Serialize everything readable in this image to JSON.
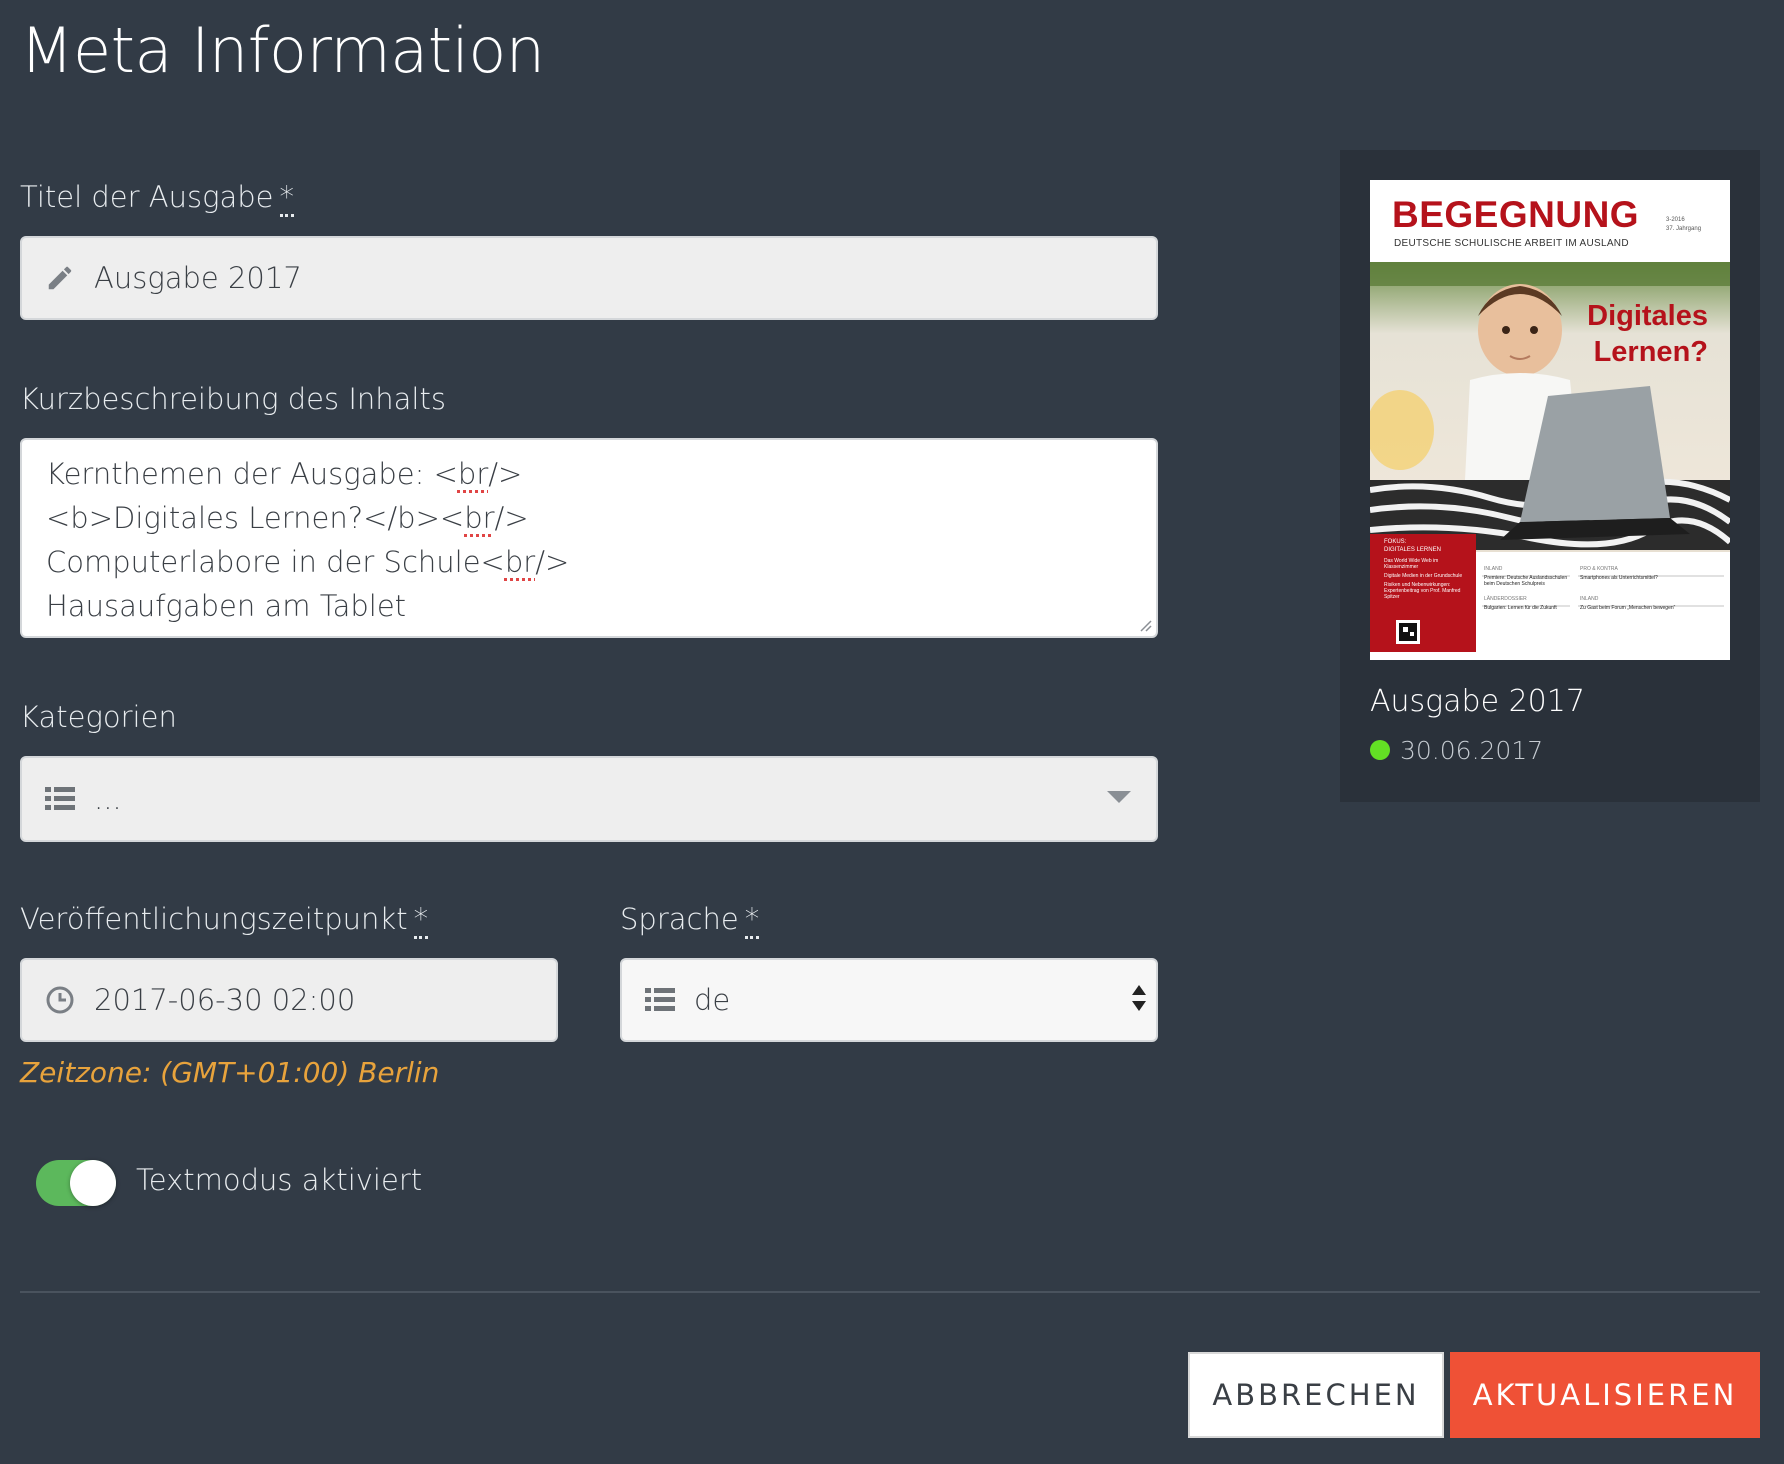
{
  "page": {
    "title": "Meta Information"
  },
  "form": {
    "title_field": {
      "label": "Titel der Ausgabe",
      "required_marker": "*",
      "value": "Ausgabe 2017",
      "icon": "pencil-icon"
    },
    "description_field": {
      "label": "Kurzbeschreibung des Inhalts",
      "lines": [
        {
          "pre": "Kernthemen der Ausgabe: <",
          "spell": "br",
          "post": "/>"
        },
        {
          "pre": "<b>Digitales Lernen?</b><",
          "spell": "br",
          "post": "/>"
        },
        {
          "pre": "Computerlabore in der Schule<",
          "spell": "br",
          "post": "/>"
        },
        {
          "pre": "Hausaufgaben am Tablet",
          "spell": "",
          "post": ""
        }
      ]
    },
    "categories_field": {
      "label": "Kategorien",
      "value": "...",
      "icon": "list-icon",
      "dropdown_icon": "caret-down-icon"
    },
    "publish_field": {
      "label": "Veröffentlichungszeitpunkt",
      "required_marker": "*",
      "value": "2017-06-30 02:00",
      "icon": "clock-icon"
    },
    "timezone_hint": "Zeitzone: (GMT+01:00) Berlin",
    "language_field": {
      "label": "Sprache",
      "required_marker": "*",
      "value": "de",
      "icon": "list-icon",
      "spinner_icon": "sort-icon"
    },
    "text_mode_toggle": {
      "label": "Textmodus aktiviert",
      "checked": true
    }
  },
  "actions": {
    "cancel_label": "ABBRECHEN",
    "update_label": "AKTUALISIEREN"
  },
  "preview": {
    "cover": {
      "masthead": "BEGEGNUNG",
      "tagline": "DEUTSCHE SCHULISCHE ARBEIT IM AUSLAND",
      "issue_lines": [
        "3-2016",
        "37. Jahrgang"
      ],
      "headline_lines": [
        "Digitales",
        "Lernen?"
      ],
      "focus_box": {
        "heading_lines": [
          "FOKUS:",
          "DIGITALES LERNEN"
        ],
        "items": [
          "Das World Wide Web im Klassenzimmer",
          "Digitale Medien in der Grundschule",
          "Risiken und Nebenwirkungen: Expertenbeitrag von Prof. Manfred Spitzer"
        ]
      },
      "columns": [
        {
          "heading": "INLAND",
          "text": "Premiere: Deutsche Auslandsschulen beim Deutschen Schulpreis"
        },
        {
          "heading": "PRO & KONTRA",
          "text": "Smartphones als Unterrichtsmittel?"
        },
        {
          "heading": "LÄNDERDOSSIER",
          "text": "Bulgarien: Lernen für die Zukunft"
        },
        {
          "heading": "INLAND",
          "text": "Zu Gast beim Forum „Menschen bewegen“"
        }
      ]
    },
    "title": "Ausgabe 2017",
    "date": "30.06.2017",
    "status_color": "#63e024"
  },
  "colors": {
    "background": "#323b46",
    "accent": "#ef5136",
    "toggle_on": "#5cb85c",
    "hint": "#e8a33c"
  }
}
